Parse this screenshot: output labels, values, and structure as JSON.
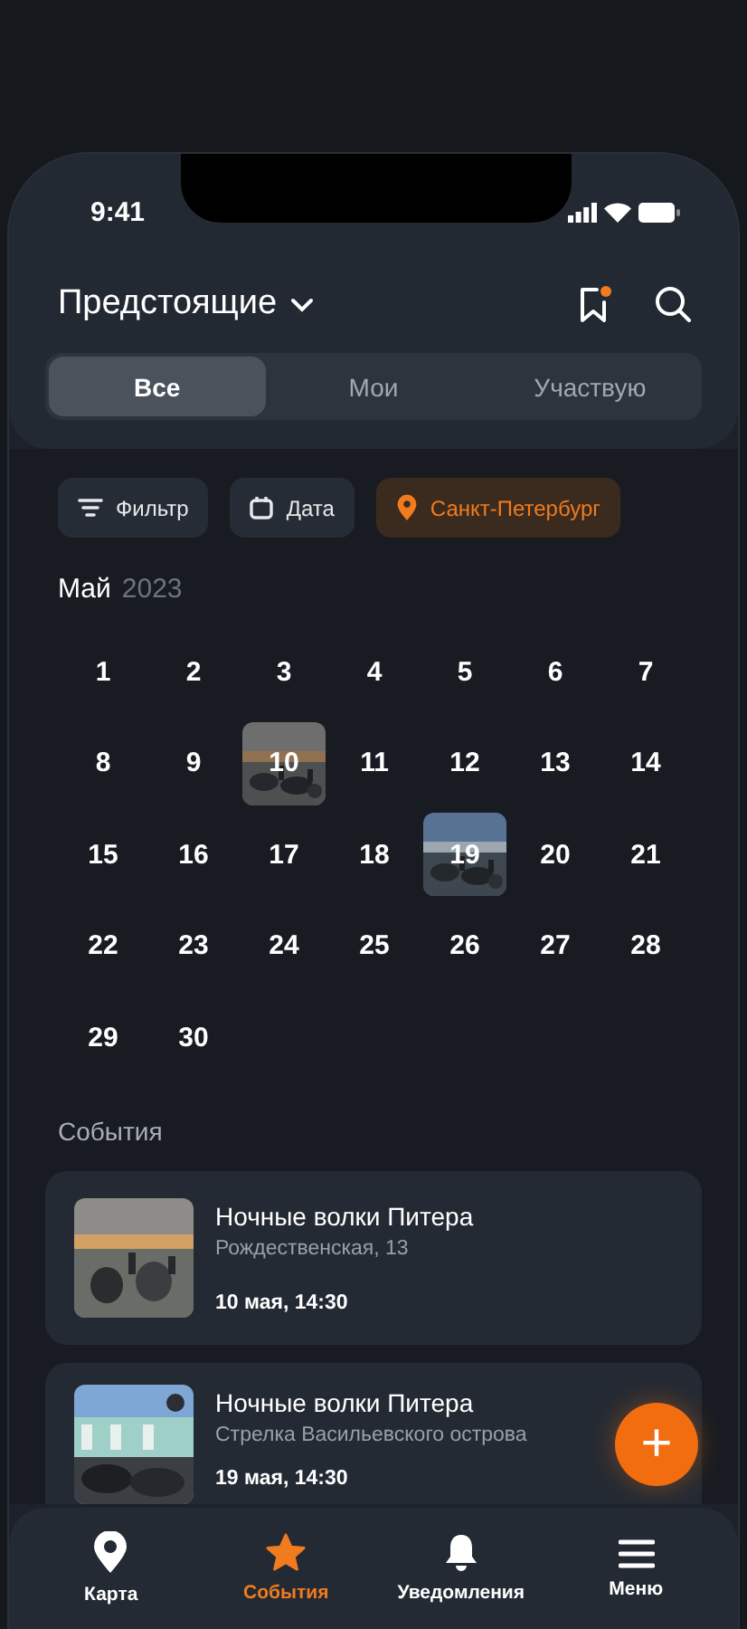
{
  "status_bar": {
    "time": "9:41"
  },
  "header": {
    "title": "Предстоящие"
  },
  "tabs": [
    {
      "label": "Все",
      "selected": true
    },
    {
      "label": "Мои",
      "selected": false
    },
    {
      "label": "Участвую",
      "selected": false
    }
  ],
  "filters": [
    {
      "label": "Фильтр",
      "kind": "filter",
      "selected": false
    },
    {
      "label": "Дата",
      "kind": "date",
      "selected": false
    },
    {
      "label": "Санкт-Петербург",
      "kind": "location",
      "selected": true
    }
  ],
  "calendar": {
    "month": "Май",
    "year": "2023",
    "days": [
      {
        "label": "1",
        "has_photo": false
      },
      {
        "label": "2",
        "has_photo": false
      },
      {
        "label": "3",
        "has_photo": false
      },
      {
        "label": "4",
        "has_photo": false
      },
      {
        "label": "5",
        "has_photo": false
      },
      {
        "label": "6",
        "has_photo": false
      },
      {
        "label": "7",
        "has_photo": false
      },
      {
        "label": "8",
        "has_photo": false
      },
      {
        "label": "9",
        "has_photo": false
      },
      {
        "label": "10",
        "has_photo": true
      },
      {
        "label": "11",
        "has_photo": false
      },
      {
        "label": "12",
        "has_photo": false
      },
      {
        "label": "13",
        "has_photo": false
      },
      {
        "label": "14",
        "has_photo": false
      },
      {
        "label": "15",
        "has_photo": false
      },
      {
        "label": "16",
        "has_photo": false
      },
      {
        "label": "17",
        "has_photo": false
      },
      {
        "label": "18",
        "has_photo": false
      },
      {
        "label": "19",
        "has_photo": true
      },
      {
        "label": "20",
        "has_photo": false
      },
      {
        "label": "21",
        "has_photo": false
      },
      {
        "label": "22",
        "has_photo": false
      },
      {
        "label": "23",
        "has_photo": false
      },
      {
        "label": "24",
        "has_photo": false
      },
      {
        "label": "25",
        "has_photo": false
      },
      {
        "label": "26",
        "has_photo": false
      },
      {
        "label": "27",
        "has_photo": false
      },
      {
        "label": "28",
        "has_photo": false
      },
      {
        "label": "29",
        "has_photo": false
      },
      {
        "label": "30",
        "has_photo": false
      }
    ]
  },
  "events": {
    "heading": "События",
    "items": [
      {
        "title": "Ночные волки Питера",
        "address": "Рождественская, 13",
        "date": "10 мая, 14:30"
      },
      {
        "title": "Ночные волки Питера",
        "address": "Стрелка Васильевского острова",
        "date": "19 мая, 14:30"
      }
    ]
  },
  "fab": {
    "label": "+"
  },
  "nav": [
    {
      "label": "Карта",
      "kind": "map",
      "selected": false
    },
    {
      "label": "События",
      "kind": "events",
      "selected": true
    },
    {
      "label": "Уведомления",
      "kind": "bell",
      "selected": false
    },
    {
      "label": "Меню",
      "kind": "menu",
      "selected": false
    }
  ]
}
